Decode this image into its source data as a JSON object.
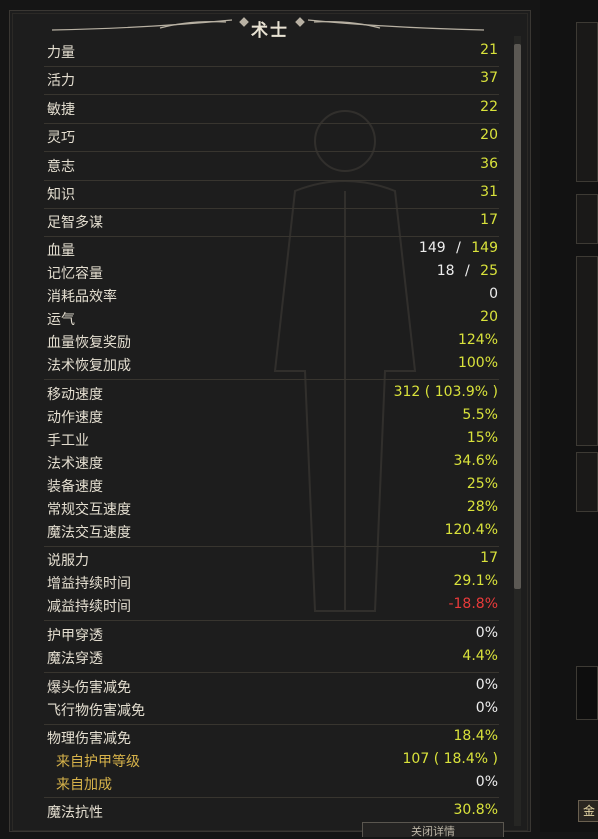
{
  "header": {
    "title": "术士"
  },
  "stats": [
    {
      "label": "力量",
      "value": "21",
      "color": "yellow"
    },
    {
      "label": "活力",
      "value": "37",
      "color": "yellow"
    },
    {
      "label": "敏捷",
      "value": "22",
      "color": "yellow"
    },
    {
      "label": "灵巧",
      "value": "20",
      "color": "yellow"
    },
    {
      "label": "意志",
      "value": "36",
      "color": "yellow"
    },
    {
      "label": "知识",
      "value": "31",
      "color": "yellow"
    },
    {
      "label": "足智多谋",
      "value": "17",
      "color": "yellow"
    },
    {
      "label": "血量",
      "value_current": "149",
      "value_sep": "/",
      "value_max": "149"
    },
    {
      "label": "记忆容量",
      "value_current": "18",
      "value_sep": "/",
      "value_max": "25"
    },
    {
      "label": "消耗品效率",
      "value": "0",
      "color": "white"
    },
    {
      "label": "运气",
      "value": "20",
      "color": "yellow"
    },
    {
      "label": "血量恢复奖励",
      "value": "124%",
      "color": "yellow"
    },
    {
      "label": "法术恢复加成",
      "value": "100%",
      "color": "yellow"
    },
    {
      "label": "移动速度",
      "value": "312 ( 103.9% )",
      "color": "yellow"
    },
    {
      "label": "动作速度",
      "value": "5.5%",
      "color": "yellow"
    },
    {
      "label": "手工业",
      "value": "15%",
      "color": "yellow"
    },
    {
      "label": "法术速度",
      "value": "34.6%",
      "color": "yellow"
    },
    {
      "label": "装备速度",
      "value": "25%",
      "color": "yellow"
    },
    {
      "label": "常规交互速度",
      "value": "28%",
      "color": "yellow"
    },
    {
      "label": "魔法交互速度",
      "value": "120.4%",
      "color": "yellow"
    },
    {
      "label": "说服力",
      "value": "17",
      "color": "yellow"
    },
    {
      "label": "增益持续时间",
      "value": "29.1%",
      "color": "yellow"
    },
    {
      "label": "减益持续时间",
      "value": "-18.8%",
      "color": "red"
    },
    {
      "label": "护甲穿透",
      "value": "0%",
      "color": "white"
    },
    {
      "label": "魔法穿透",
      "value": "4.4%",
      "color": "yellow"
    },
    {
      "label": "爆头伤害减免",
      "value": "0%",
      "color": "white"
    },
    {
      "label": "飞行物伤害减免",
      "value": "0%",
      "color": "white"
    },
    {
      "label": "物理伤害减免",
      "value": "18.4%",
      "color": "yellow"
    },
    {
      "label": "来自护甲等级",
      "value": "107 ( 18.4% )",
      "color": "yellow",
      "sub": true
    },
    {
      "label": "来自加成",
      "value": "0%",
      "color": "white",
      "sub": true
    },
    {
      "label": "魔法抗性",
      "value": "30.8%",
      "color": "yellow"
    }
  ],
  "footer": {
    "button_label": "关闭详情",
    "gold_label": "金"
  },
  "colors": {
    "stat_yellow": "#d9e23b",
    "negative_red": "#e83a3a",
    "label": "#e4ded0",
    "sub_label": "#d6b24a"
  }
}
